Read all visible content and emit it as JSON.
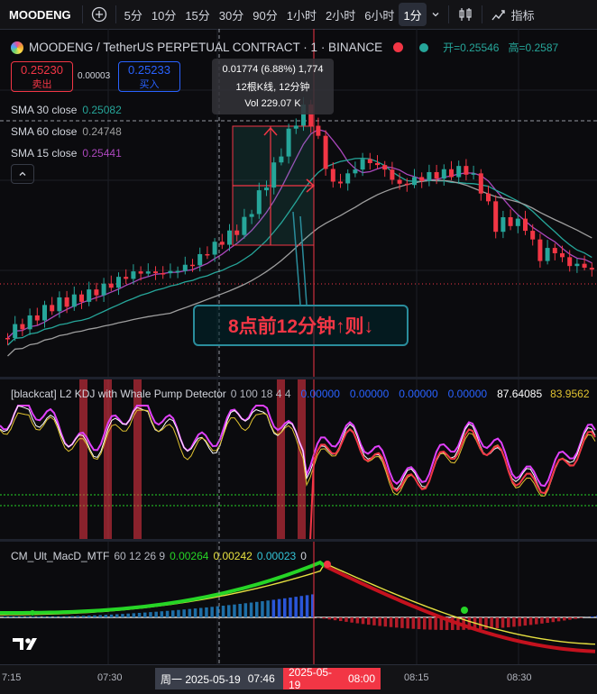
{
  "toolbar": {
    "symbol": "MOODENG",
    "intervals": [
      "5分",
      "10分",
      "15分",
      "30分",
      "90分",
      "1小时",
      "2小时",
      "6小时",
      "1分"
    ],
    "active_interval": "1分",
    "indicators_label": "指标"
  },
  "header": {
    "title": "MOODENG / TetherUS PERPETUAL CONTRACT · 1 · BINANCE",
    "open_label": "开=0.25546",
    "high_label": "高=0.2587"
  },
  "trade": {
    "sell_price": "0.25230",
    "sell_label": "卖出",
    "spread": "0.00003",
    "buy_price": "0.25233",
    "buy_label": "买入"
  },
  "sma": [
    {
      "label": "SMA 30 close",
      "value": "0.25082",
      "color": "#26a69a"
    },
    {
      "label": "SMA 60 close",
      "value": "0.24748",
      "color": "#9e9e9e"
    },
    {
      "label": "SMA 15 close",
      "value": "0.25441",
      "color": "#ab47bc"
    }
  ],
  "tooltip": {
    "line1": "0.01774 (6.88%) 1,774",
    "line2": "12根K线, 12分钟",
    "line3": "Vol 229.07 K"
  },
  "annotation": "8点前12分钟↑则↓",
  "kdj": {
    "title": "[blackcat] L2 KDJ with Whale Pump Detector",
    "params": "0 100 18 4 4",
    "values": [
      "0.00000",
      "0.00000",
      "0.00000",
      "0.00000"
    ],
    "k_value": "87.64085",
    "d_value": "83.9562"
  },
  "macd": {
    "title": "CM_Ult_MacD_MTF",
    "params": "60 12 26 9",
    "v1": "0.00264",
    "v2": "0.00242",
    "v3": "0.00023",
    "v4": "0"
  },
  "time_axis": {
    "labels": [
      "7:15",
      "07:30",
      "08:15",
      "08:30"
    ],
    "cursor_date": "周一 2025-05-19",
    "cursor_time": "07:46",
    "marker_date": "2025-05-19",
    "marker_time": "08:00"
  },
  "colors": {
    "up": "#26a69a",
    "down": "#f23645",
    "accent": "#2962ff",
    "background": "#0b0b0e"
  }
}
